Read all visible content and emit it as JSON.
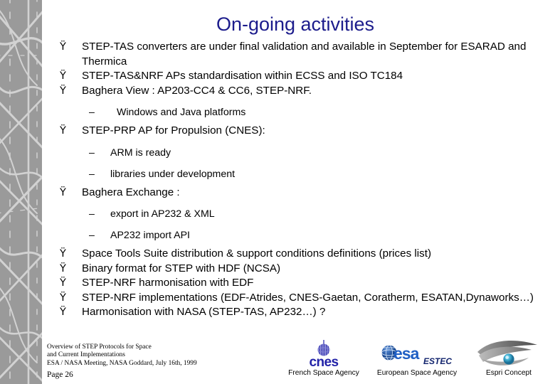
{
  "slide": {
    "title": "On-going activities",
    "title_color": "#1c1c8c",
    "background_color": "#ffffff",
    "sidebar_color": "#9a9a9a"
  },
  "bullets": [
    {
      "level": 1,
      "marker": "Ÿ",
      "text": "STEP-TAS converters are under final validation and available in September for ESARAD and Thermica"
    },
    {
      "level": 1,
      "marker": "Ÿ",
      "text": "STEP-TAS&NRF APs standardisation within ECSS and ISO TC184"
    },
    {
      "level": 1,
      "marker": "Ÿ",
      "text": "Baghera View : AP203-CC4 & CC6, STEP-NRF."
    },
    {
      "level": 2,
      "marker": "–",
      "text": "Windows and Java platforms"
    },
    {
      "level": 1,
      "marker": "Ÿ",
      "text": "STEP-PRP AP for Propulsion (CNES):"
    },
    {
      "level": 2,
      "marker": "–",
      "text": "ARM is ready"
    },
    {
      "level": 2,
      "marker": "–",
      "text": "libraries under development"
    },
    {
      "level": 1,
      "marker": "Ÿ",
      "text": "Baghera Exchange :"
    },
    {
      "level": 2,
      "marker": "–",
      "text": "export in AP232 & XML"
    },
    {
      "level": 2,
      "marker": "–",
      "text": "AP232 import API"
    },
    {
      "level": 1,
      "marker": "Ÿ",
      "text": "Space Tools Suite distribution & support conditions definitions (prices list)"
    },
    {
      "level": 1,
      "marker": "Ÿ",
      "text": "Binary format for STEP with HDF (NCSA)"
    },
    {
      "level": 1,
      "marker": "Ÿ",
      "text": "STEP-NRF harmonisation with EDF"
    },
    {
      "level": 1,
      "marker": "Ÿ",
      "text": "STEP-NRF implementations (EDF-Atrides, CNES-Gaetan, Coratherm, ESATAN,Dynaworks…)"
    },
    {
      "level": 1,
      "marker": "Ÿ",
      "text": "Harmonisation with NASA (STEP-TAS, AP232…) ?"
    }
  ],
  "footer": {
    "line1": "Overview of STEP Protocols for Space",
    "line2": "and Current Implementations",
    "line3": "ESA / NASA Meeting, NASA Goddard, July 16th, 1999",
    "page": "Page 26"
  },
  "logos": [
    {
      "id": "cnes",
      "wordmark": "cnes",
      "sub": "",
      "caption": "French Space Agency",
      "color": "#2222a8"
    },
    {
      "id": "esa",
      "wordmark": "esa",
      "sub": "ESTEC",
      "caption": "European Space Agency",
      "color": "#1f5fc4"
    },
    {
      "id": "espri",
      "wordmark": "",
      "sub": "",
      "caption": "Espri Concept",
      "color": "#7b7b7b"
    }
  ]
}
